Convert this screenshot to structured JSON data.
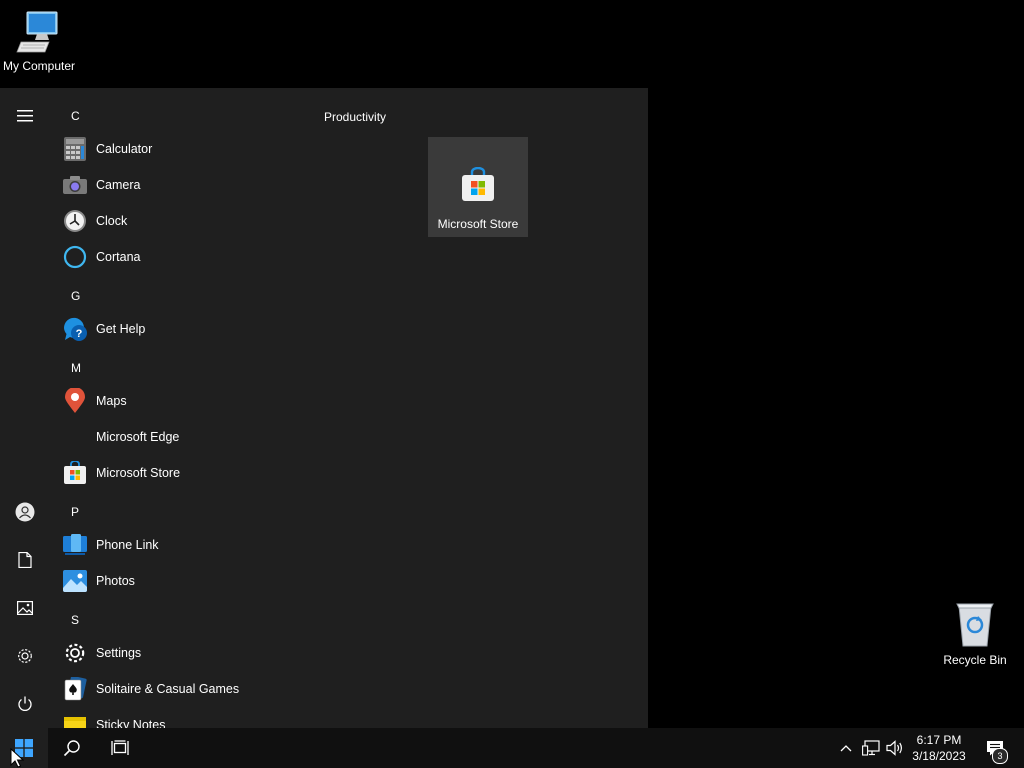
{
  "desktop": {
    "icons": [
      {
        "label": "My Computer"
      },
      {
        "label": "Recycle Bin"
      }
    ]
  },
  "start_menu": {
    "sections": [
      {
        "letter": "C",
        "apps": [
          "Calculator",
          "Camera",
          "Clock",
          "Cortana"
        ]
      },
      {
        "letter": "G",
        "apps": [
          "Get Help"
        ]
      },
      {
        "letter": "M",
        "apps": [
          "Maps",
          "Microsoft Edge",
          "Microsoft Store"
        ]
      },
      {
        "letter": "P",
        "apps": [
          "Phone Link",
          "Photos"
        ]
      },
      {
        "letter": "S",
        "apps": [
          "Settings",
          "Solitaire & Casual Games",
          "Sticky Notes"
        ]
      }
    ],
    "group_title": "Productivity",
    "tile": {
      "label": "Microsoft Store"
    },
    "rail_icons": [
      "hamburger-menu-icon",
      "user-account-icon",
      "documents-icon",
      "pictures-icon",
      "settings-gear-icon",
      "power-icon"
    ]
  },
  "taskbar": {
    "clock_time": "6:17 PM",
    "clock_date": "3/18/2023",
    "notification_count": "3",
    "icons": [
      "windows-start-icon",
      "search-icon",
      "task-view-icon",
      "chevron-up-icon",
      "network-icon",
      "volume-icon",
      "action-center-icon"
    ]
  },
  "colors": {
    "start_menu_bg": "#1f1f1f",
    "tile_bg": "#3a3a3a",
    "taskbar_bg": "#101010",
    "accent": "#0078d4"
  }
}
